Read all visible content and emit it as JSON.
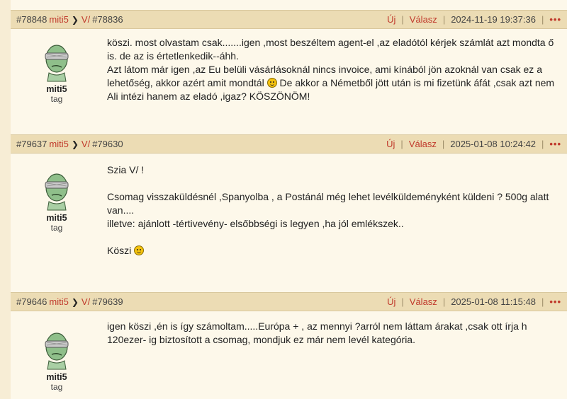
{
  "posts": [
    {
      "id": "#78848",
      "user": "miti5",
      "replyTo": "V/",
      "replyId": "#78836",
      "new_label": "Új",
      "reply_label": "Válasz",
      "date": "2024-11-19 19:37:36",
      "more": "•••",
      "author": {
        "name": "miti5",
        "rank": "tag"
      },
      "paragraphs": [
        "köszi. most olvastam csak.......igen ,most beszéltem agent-el ,az eladótól kérjek számlát azt mondta ő is. de az is értetlenkedik--áhh.",
        "Azt látom már igen ,az Eu belüli vásárlásoknál nincs invoice, ami kínából jön azoknál van csak ez a lehetőség, akkor azért amit mondtál",
        " De akkor a Németből jött után is mi fizetünk áfát ,csak azt nem Ali intézi hanem az eladó ,igaz? KÖSZÖNÖM!"
      ]
    },
    {
      "id": "#79637",
      "user": "miti5",
      "replyTo": "V/",
      "replyId": "#79630",
      "new_label": "Új",
      "reply_label": "Válasz",
      "date": "2025-01-08 10:24:42",
      "more": "•••",
      "author": {
        "name": "miti5",
        "rank": "tag"
      },
      "paragraphs": [
        "Szia V/ !",
        "Csomag visszaküldésnél ,Spanyolba , a Postánál még lehet levélküldeményként küldeni ? 500g alatt van....",
        "illetve: ajánlott -tértivevény- elsőbbségi is legyen ,ha jól emlékszek..",
        "Köszi"
      ]
    },
    {
      "id": "#79646",
      "user": "miti5",
      "replyTo": "V/",
      "replyId": "#79639",
      "new_label": "Új",
      "reply_label": "Válasz",
      "date": "2025-01-08 11:15:48",
      "more": "•••",
      "author": {
        "name": "miti5",
        "rank": "tag"
      },
      "paragraphs": [
        "igen köszi ,én is így számoltam.....Európa + , az mennyi ?arról nem láttam árakat ,csak ott írja h 120ezer- ig biztosított a csomag, mondjuk ez már nem levél kategória."
      ]
    }
  ]
}
